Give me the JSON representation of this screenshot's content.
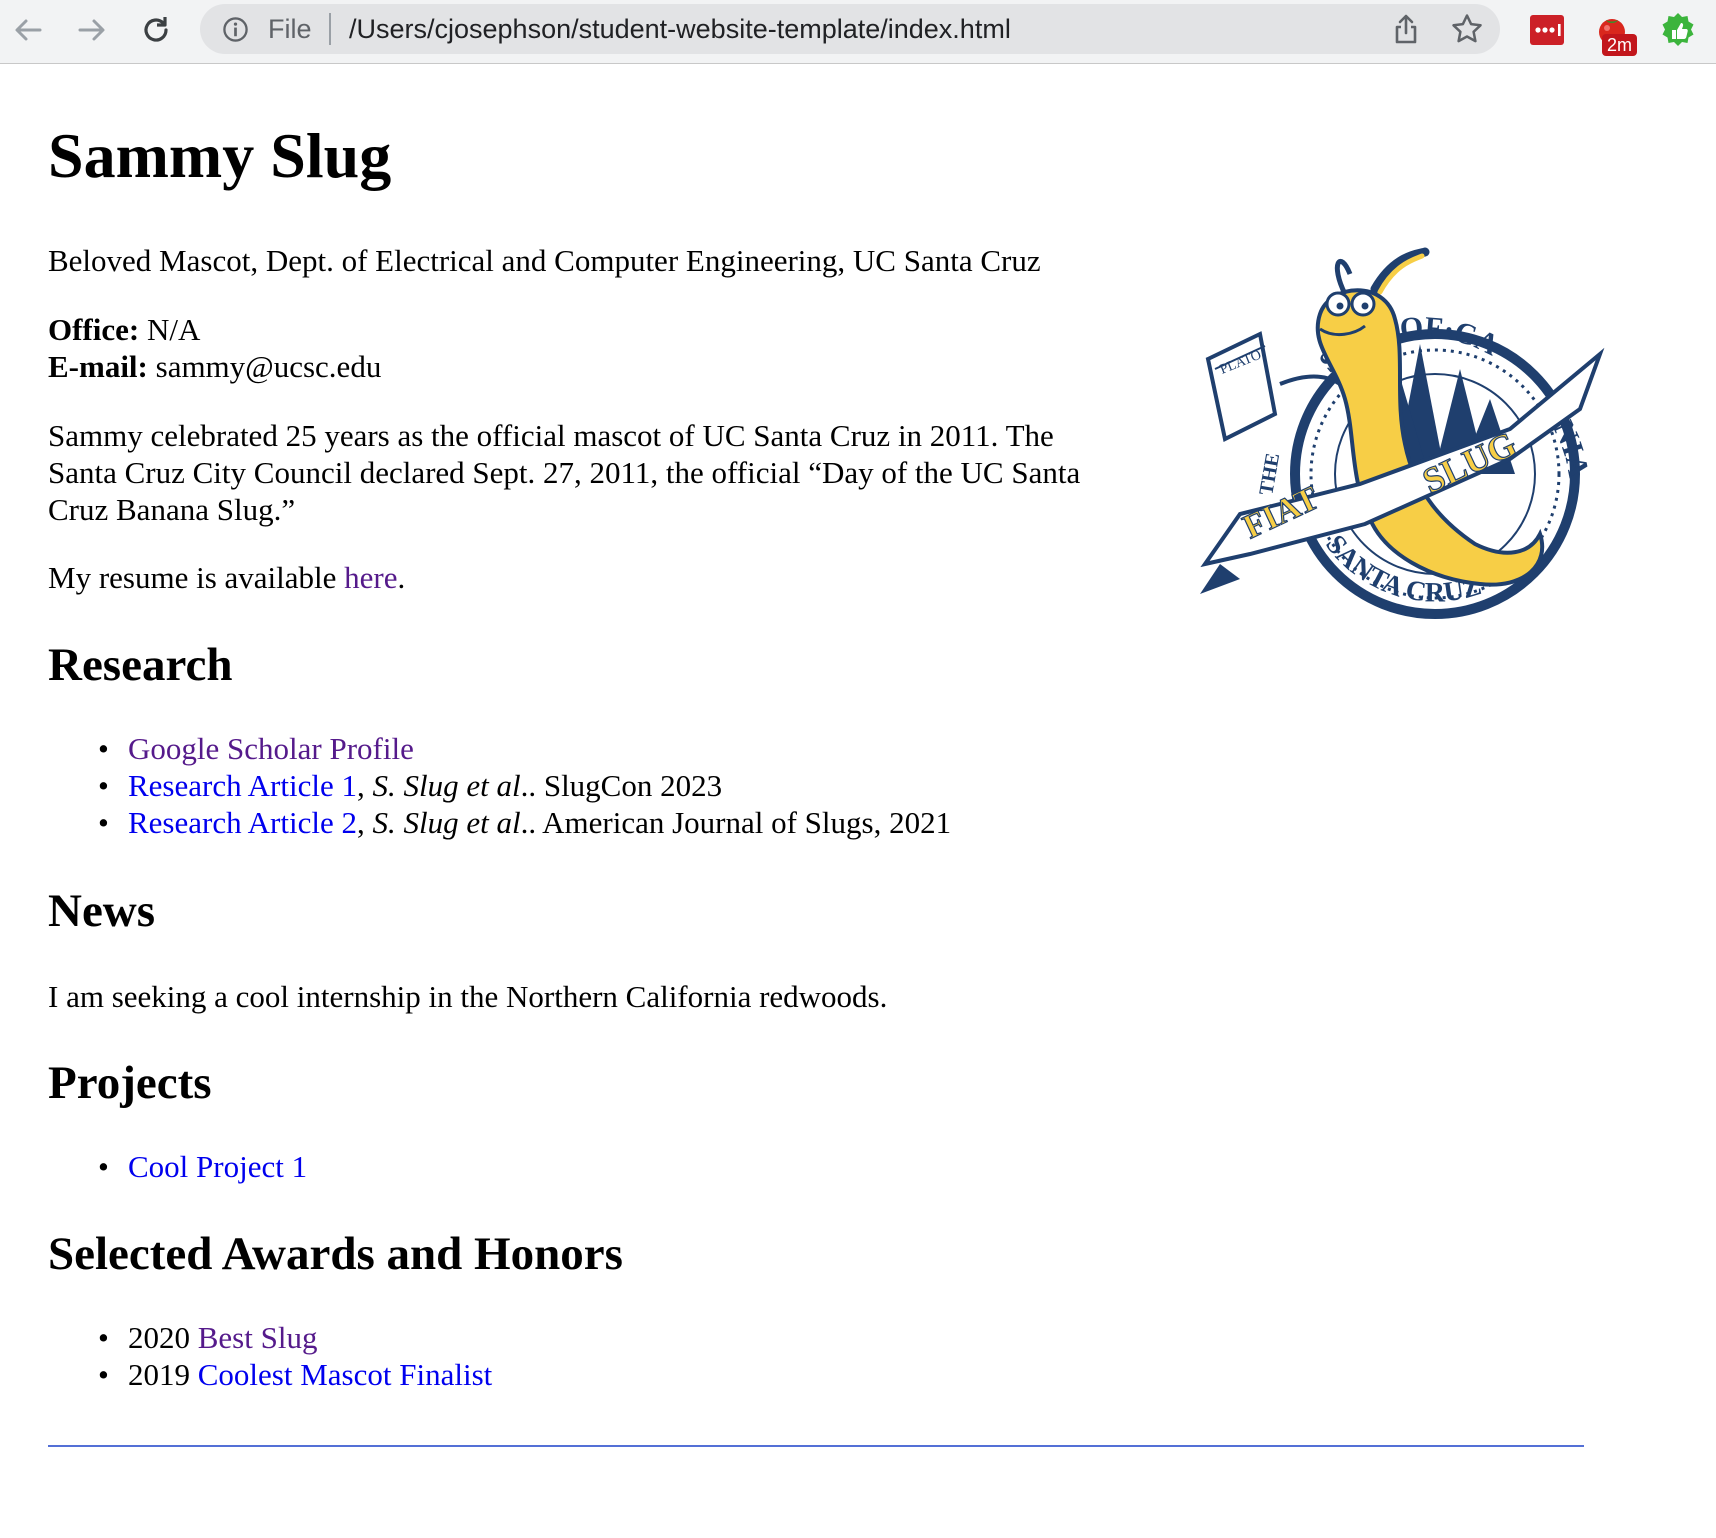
{
  "browser": {
    "scheme_label": "File",
    "url": "/Users/cjosephson/student-website-template/index.html",
    "extension_badge": "2m"
  },
  "header": {
    "name": "Sammy Slug",
    "position": "Beloved Mascot, Dept. of Electrical and Computer Engineering, UC Santa Cruz"
  },
  "contact": {
    "office_label": "Office:",
    "office_value": " N/A",
    "email_label": "E-mail:",
    "email_value": " sammy@ucsc.edu"
  },
  "bio": "Sammy celebrated 25 years as the official mascot of UC Santa Cruz in 2011. The Santa Cruz City Council declared Sept. 27, 2011, the official “Day of the UC Santa Cruz Banana Slug.”",
  "resume": {
    "prefix": "My resume is available ",
    "link": "here",
    "suffix": "."
  },
  "logo": {
    "text_top": "SITY·OF·CA",
    "text_right": "RNIA",
    "text_bottom": "SANTA CRUZ",
    "banner_left": "FIAT",
    "banner_right": "SLUG",
    "book": "PLATO",
    "small": "THE",
    "navy": "#1f3f6e",
    "yellow": "#f7ce46"
  },
  "research": {
    "heading": "Research",
    "items": [
      {
        "link": "Google Scholar Profile",
        "rest_pre": "",
        "authors": "",
        "rest_post": ""
      },
      {
        "link": "Research Article 1",
        "rest_pre": ", ",
        "authors": "S. Slug et al",
        "rest_post": ".. SlugCon 2023"
      },
      {
        "link": "Research Article 2",
        "rest_pre": ", ",
        "authors": "S. Slug et al",
        "rest_post": ".. American Journal of Slugs, 2021"
      }
    ]
  },
  "news": {
    "heading": "News",
    "text": "I am seeking a cool internship in the Northern California redwoods."
  },
  "projects": {
    "heading": "Projects",
    "items": [
      {
        "link": "Cool Project 1"
      }
    ]
  },
  "awards": {
    "heading": "Selected Awards and Honors",
    "items": [
      {
        "year": "2020 ",
        "link": "Best Slug"
      },
      {
        "year": "2019 ",
        "link": "Coolest Mascot Finalist"
      }
    ]
  }
}
